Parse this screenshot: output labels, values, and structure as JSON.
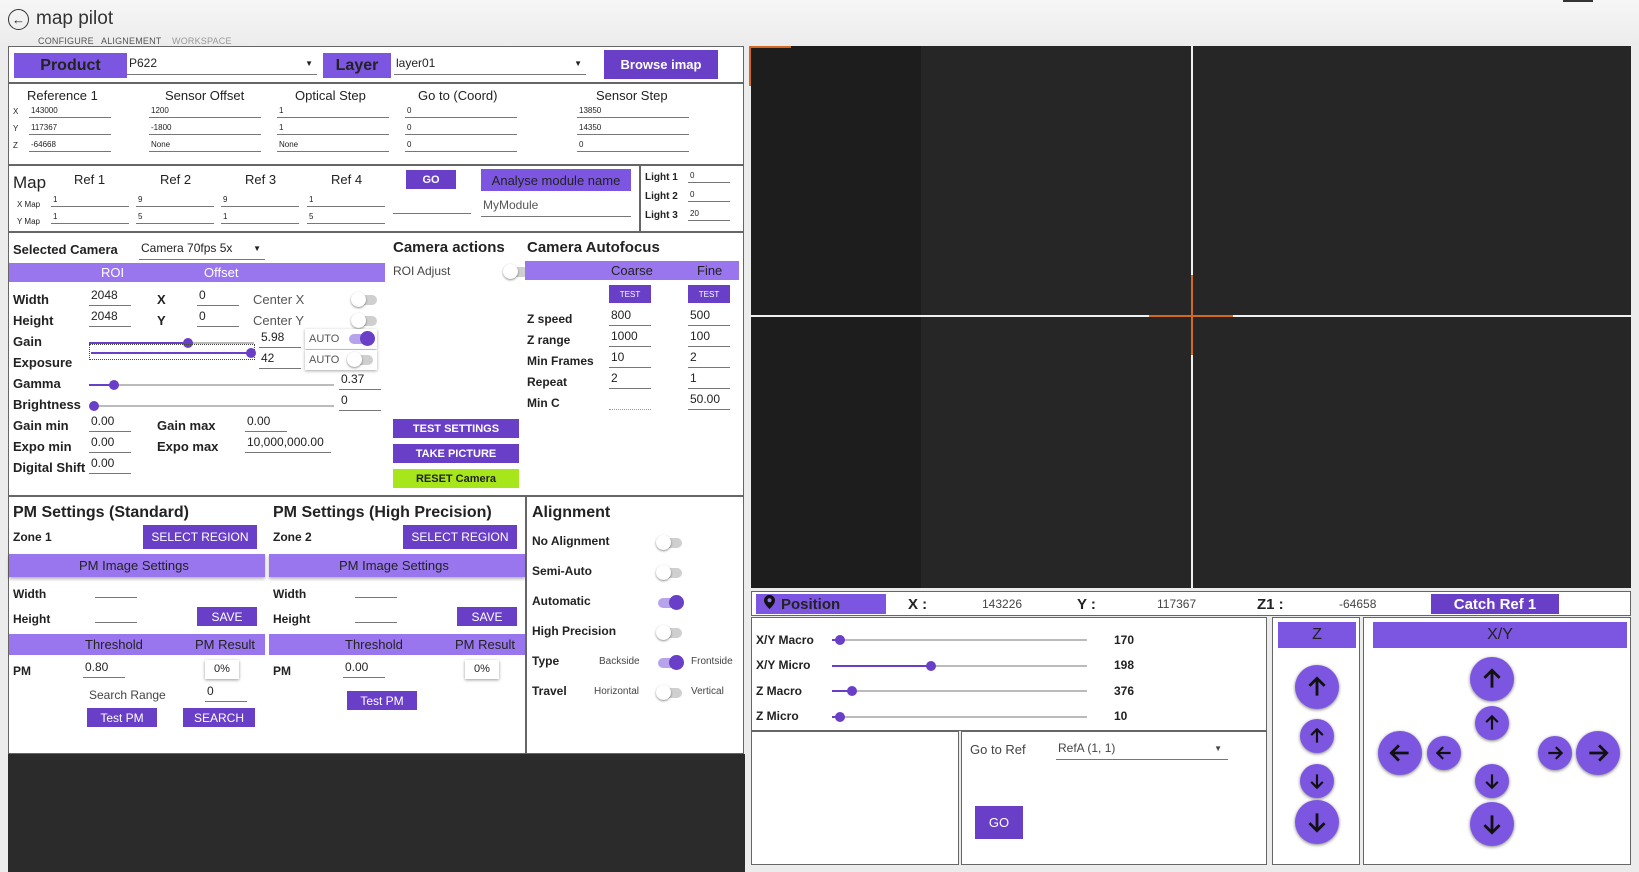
{
  "app": {
    "title": "map pilot",
    "tabs": [
      "CONFIGURE",
      "ALIGNEMENT",
      "WORKSPACE"
    ]
  },
  "top": {
    "product_label": "Product",
    "product_value": "P622",
    "layer_label": "Layer",
    "layer_value": "layer01",
    "browse_label": "Browse imap"
  },
  "coords": {
    "headers": [
      "Reference 1",
      "Sensor Offset",
      "Optical Step",
      "Go to (Coord)",
      "Sensor Step"
    ],
    "row_labels": [
      "X",
      "Y",
      "Z"
    ],
    "ref1": [
      "143000",
      "117367",
      "-64668"
    ],
    "sensor_offset": [
      "1200",
      "-1800",
      "None"
    ],
    "optical_step": [
      "1",
      "1",
      "None"
    ],
    "goto": [
      "0",
      "0",
      "0"
    ],
    "sensor_step": [
      "13850",
      "14350",
      "0"
    ]
  },
  "map": {
    "title": "Map",
    "refs": [
      "Ref 1",
      "Ref 2",
      "Ref 3",
      "Ref 4"
    ],
    "xmap_label": "X Map",
    "ymap_label": "Y Map",
    "xmap": [
      "1",
      "9",
      "9",
      "1"
    ],
    "ymap": [
      "1",
      "5",
      "1",
      "5"
    ],
    "go_label": "GO",
    "analyse_label": "Analyse module name",
    "module_name": "MyModule",
    "lights": [
      {
        "label": "Light 1",
        "value": "0"
      },
      {
        "label": "Light 2",
        "value": "0"
      },
      {
        "label": "Light 3",
        "value": "20"
      }
    ]
  },
  "camera": {
    "selected_label": "Selected Camera",
    "selected_value": "Camera 70fps 5x",
    "roi_label": "ROI",
    "offset_label": "Offset",
    "width_label": "Width",
    "width": "2048",
    "height_label": "Height",
    "height": "2048",
    "x_label": "X",
    "x": "0",
    "y_label": "Y",
    "y": "0",
    "centerx_label": "Center X",
    "centery_label": "Center Y",
    "gain_label": "Gain",
    "gain": "5.98",
    "gain_frac": 0.6,
    "exposure_label": "Exposure",
    "exposure": "42",
    "exposure_frac": 1.0,
    "gamma_label": "Gamma",
    "gamma": "0.37",
    "gamma_frac": 0.1,
    "brightness_label": "Brightness",
    "brightness": "0",
    "brightness_frac": 0.0,
    "auto_label": "AUTO",
    "gainmin_label": "Gain min",
    "gainmin": "0.00",
    "gainmax_label": "Gain max",
    "gainmax": "0.00",
    "expomin_label": "Expo min",
    "expomin": "0.00",
    "expomax_label": "Expo max",
    "expomax": "10,000,000.00",
    "dshift_label": "Digital Shift",
    "dshift": "0.00"
  },
  "camera_actions": {
    "title": "Camera actions",
    "roi_adjust": "ROI Adjust",
    "test_settings": "TEST SETTINGS",
    "take_picture": "TAKE PICTURE",
    "reset_camera": "RESET Camera"
  },
  "autofocus": {
    "title": "Camera Autofocus",
    "coarse": "Coarse",
    "fine": "Fine",
    "test": "TEST",
    "rows": [
      {
        "label": "Z speed",
        "coarse": "800",
        "fine": "500"
      },
      {
        "label": "Z range",
        "coarse": "1000",
        "fine": "100"
      },
      {
        "label": "Min Frames",
        "coarse": "10",
        "fine": "2"
      },
      {
        "label": "Repeat",
        "coarse": "2",
        "fine": "1"
      },
      {
        "label": "Min C",
        "coarse": "",
        "fine": "50.00"
      }
    ]
  },
  "pm_std": {
    "title": "PM Settings (Standard)",
    "zone": "Zone 1",
    "select_region": "SELECT REGION",
    "image_settings": "PM Image Settings",
    "width": "Width",
    "height": "Height",
    "save": "SAVE",
    "threshold": "Threshold",
    "pm_result": "PM Result",
    "pm_label": "PM",
    "pm_value": "0.80",
    "pm_percent": "0%",
    "search_range_label": "Search Range",
    "search_range": "0",
    "test_pm": "Test PM",
    "search": "SEARCH"
  },
  "pm_hp": {
    "title": "PM Settings (High Precision)",
    "zone": "Zone 2",
    "select_region": "SELECT REGION",
    "image_settings": "PM Image Settings",
    "width": "Width",
    "height": "Height",
    "save": "SAVE",
    "threshold": "Threshold",
    "pm_result": "PM Result",
    "pm_label": "PM",
    "pm_value": "0.00",
    "pm_percent": "0%",
    "test_pm": "Test PM"
  },
  "alignment": {
    "title": "Alignment",
    "no_alignment": "No Alignment",
    "semi_auto": "Semi-Auto",
    "automatic": "Automatic",
    "high_precision": "High Precision",
    "type": "Type",
    "backside": "Backside",
    "frontside": "Frontside",
    "travel": "Travel",
    "horizontal": "Horizontal",
    "vertical": "Vertical"
  },
  "position": {
    "label": "Position",
    "x_label": "X :",
    "x": "143226",
    "y_label": "Y :",
    "y": "117367",
    "z_label": "Z1 :",
    "z": "-64658",
    "catch_label": "Catch Ref 1"
  },
  "speeds": [
    {
      "label": "X/Y Macro",
      "value": "170",
      "frac": 0.03
    },
    {
      "label": "X/Y Micro",
      "value": "198",
      "frac": 0.39
    },
    {
      "label": "Z Macro",
      "value": "376",
      "frac": 0.08
    },
    {
      "label": "Z Micro",
      "value": "10",
      "frac": 0.03
    }
  ],
  "goto_ref": {
    "label": "Go to Ref",
    "value": "RefA (1, 1)",
    "go": "GO"
  },
  "jog": {
    "z_label": "Z",
    "xy_label": "X/Y"
  },
  "colors": {
    "accent": "#7c56e0",
    "accent_dark": "#6a3fc8",
    "reset": "#a6e61a",
    "crosshair": "#d2691e"
  }
}
